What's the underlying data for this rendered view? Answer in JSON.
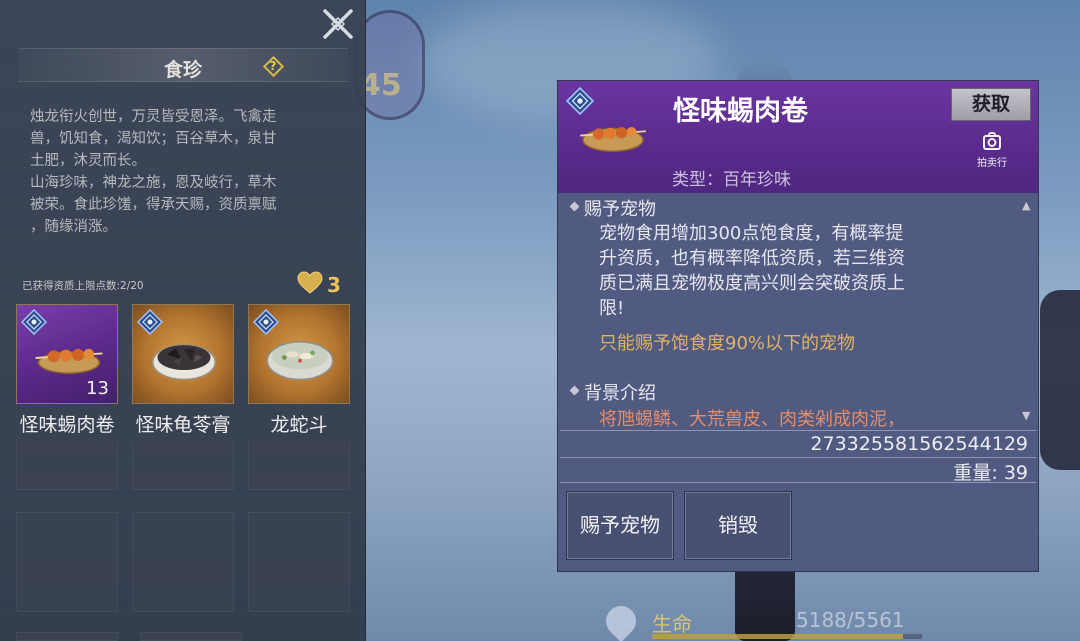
{
  "pet_food_panel": {
    "title": "食珍",
    "description": "烛龙衔火创世，万灵皆受恩泽。飞禽走\n兽，饥知食，渴知饮；百谷草木，泉甘\n土肥，沐灵而长。\n山海珍味，神龙之施，恩及岐行，草木\n被荣。食此珍馐，得承天赐，资质禀赋\n，随缘消涨。",
    "qualification_cap": "已获得资质上限点数:2/20",
    "hearts": "3",
    "items": [
      {
        "name": "怪味蜴肉卷",
        "qty": "13",
        "rarity": "purple"
      },
      {
        "name": "怪味龟苓膏",
        "rarity": "gold"
      },
      {
        "name": "龙蛇斗",
        "rarity": "gold"
      }
    ]
  },
  "tooltip": {
    "name": "怪味蜴肉卷",
    "obtain_label": "获取",
    "auction_label": "拍卖行",
    "type_line": "类型：百年珍味",
    "sections": [
      {
        "heading": "赐予宠物",
        "text": "宠物食用增加300点饱食度，有概率提\n升资质，也有概率降低资质，若三维资\n质已满且宠物极度高兴则会突破资质上\n限!",
        "warning": "只能赐予饱食度90%以下的宠物"
      },
      {
        "heading": "背景介绍",
        "text": "将虺蜴鳞、大荒兽皮、肉类剁成肉泥，"
      }
    ],
    "item_id": "2733255815625441​29",
    "weight": "重量: 39",
    "actions": [
      {
        "label": "赐予宠物"
      },
      {
        "label": "销毁"
      }
    ]
  },
  "hud": {
    "hp_label": "生命",
    "hp_value": "5188/5561",
    "hp_fraction": 0.93,
    "level_partial": "45"
  },
  "colors": {
    "purple_header": "#5a2b8c",
    "tooltip_body": "#515b81",
    "gold_text": "#e0b266",
    "orange_text": "#e58c6a"
  }
}
